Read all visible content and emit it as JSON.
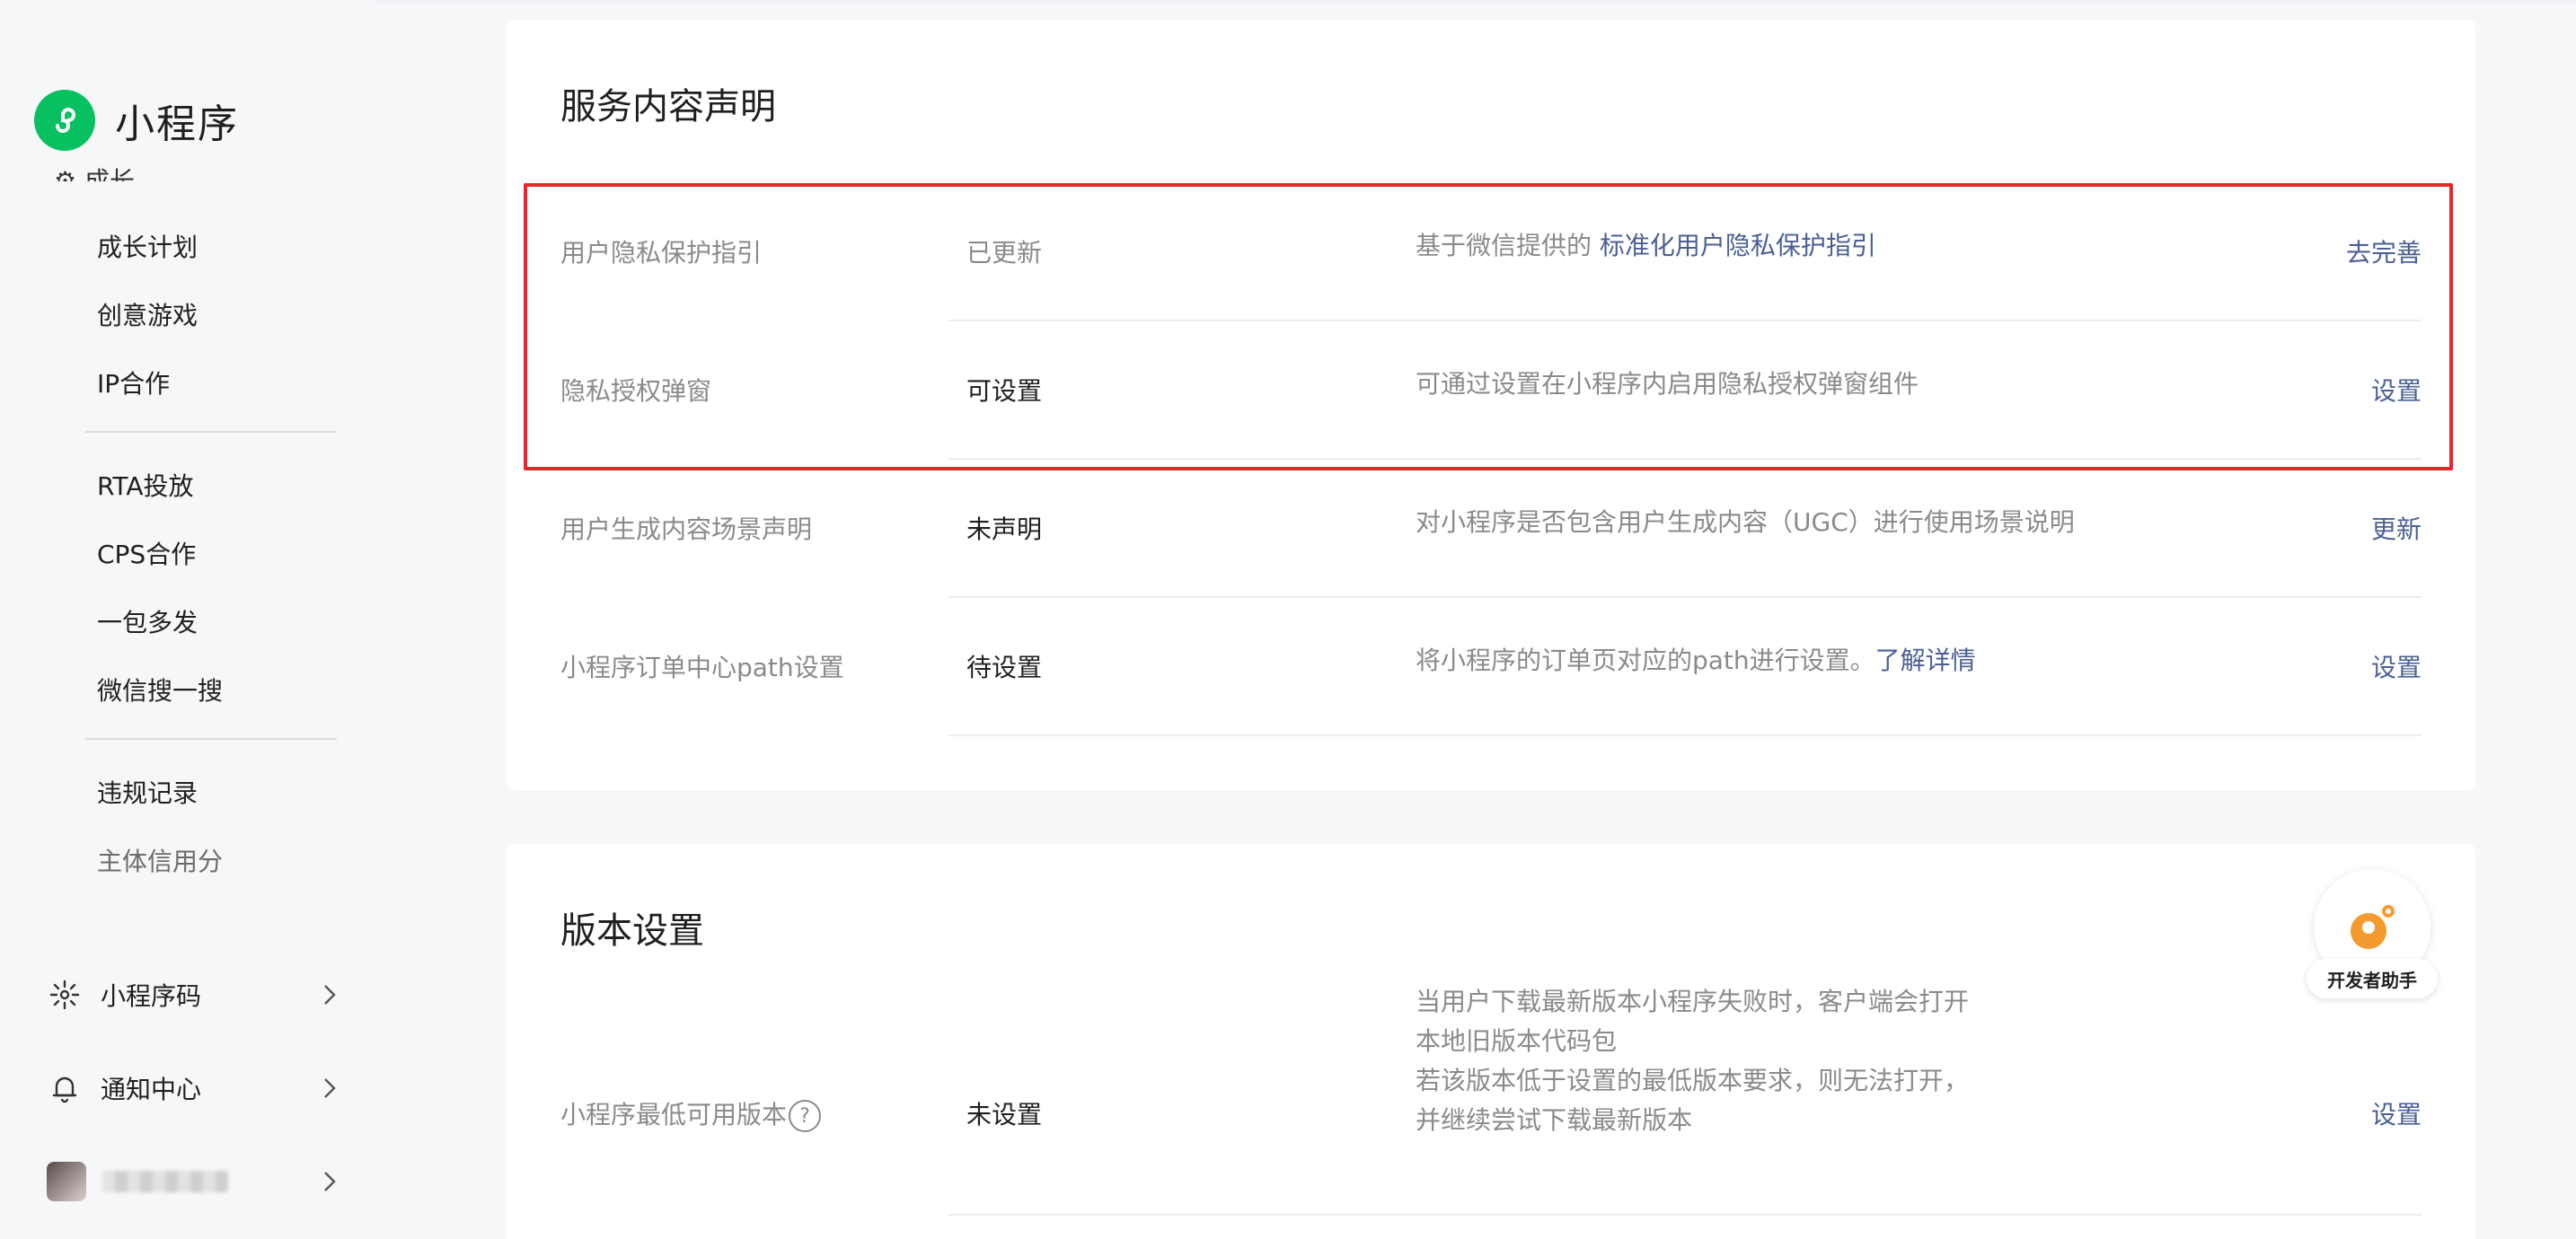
{
  "app": {
    "title": "小程序",
    "brand_color": "#07c160"
  },
  "sidebar": {
    "items_top": [
      {
        "label": "成长计划"
      },
      {
        "label": "创意游戏"
      },
      {
        "label": "IP合作"
      }
    ],
    "items_mid": [
      {
        "label": "RTA投放"
      },
      {
        "label": "CPS合作"
      },
      {
        "label": "一包多发"
      },
      {
        "label": "微信搜一搜"
      }
    ],
    "items_bottom": [
      {
        "label": "违规记录"
      },
      {
        "label": "主体信用分"
      }
    ],
    "groups": [
      {
        "label": "小程序码",
        "icon": "qrcode-sun-icon"
      },
      {
        "label": "通知中心",
        "icon": "bell-icon"
      }
    ]
  },
  "service_card": {
    "title": "服务内容声明",
    "rows": [
      {
        "label": "用户隐私保护指引",
        "status": "已更新",
        "desc_prefix": "基于微信提供的 ",
        "desc_link": "标准化用户隐私保护指引",
        "action": "去完善"
      },
      {
        "label": "隐私授权弹窗",
        "status": "可设置",
        "desc": "可通过设置在小程序内启用隐私授权弹窗组件",
        "action": "设置"
      },
      {
        "label": "用户生成内容场景声明",
        "status": "未声明",
        "desc": "对小程序是否包含用户生成内容（UGC）进行使用场景说明",
        "action": "更新"
      },
      {
        "label": "小程序订单中心path设置",
        "status": "待设置",
        "desc_prefix": "将小程序的订单页对应的path进行设置。",
        "desc_link": "了解详情",
        "action": "设置"
      }
    ]
  },
  "version_card": {
    "title": "版本设置",
    "rows": [
      {
        "label": "小程序最低可用版本",
        "help": "?",
        "status": "未设置",
        "desc_lines": [
          "当用户下载最新版本小程序失败时，客户端会打开",
          "本地旧版本代码包",
          "若该版本低于设置的最低版本要求，则无法打开，",
          "并继续尝试下载最新版本"
        ],
        "action": "设置"
      }
    ]
  },
  "helper": {
    "label": "开发者助手",
    "accent": "#f59a2e"
  },
  "highlight_color": "#e8262a",
  "link_color": "#4b5f95"
}
